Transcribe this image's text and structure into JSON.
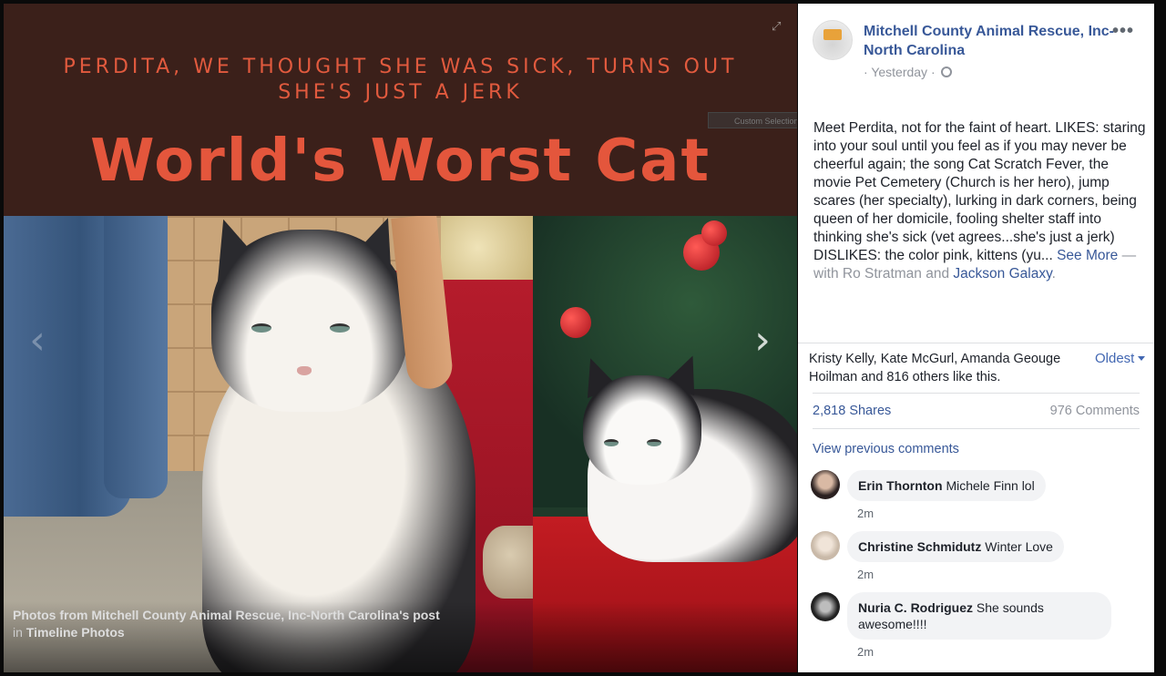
{
  "viewer": {
    "banner": {
      "subtitle_line1": "PERDITA, WE THOUGHT SHE WAS SICK, TURNS OUT",
      "subtitle_line2": "SHE'S JUST A JERK",
      "title": "World's Worst Cat"
    },
    "overlay_label": "Custom Selection",
    "caption": {
      "line1": "Photos from Mitchell County Animal Rescue, Inc-North Carolina's post",
      "line2_prefix": "in",
      "line2_link": "Timeline Photos"
    },
    "icons": {
      "expand": "expand-icon",
      "prev": "chevron-left-icon",
      "next": "chevron-right-icon"
    }
  },
  "post": {
    "page_name": "Mitchell County Animal Rescue, Inc-North Carolina",
    "timestamp": "Yesterday",
    "more_label": "•••",
    "body": "Meet Perdita, not for the faint of heart. LIKES: staring into your soul until you feel as if you may never be cheerful again; the song Cat Scratch Fever, the movie Pet Cemetery (Church is her hero), jump scares (her specialty), lurking in dark corners, being queen of her domicile, fooling shelter staff into thinking she's sick (vet agrees...she's just a jerk) DISLIKES: the color pink, kittens (yu...",
    "see_more": "See More",
    "with_prefix": "— with",
    "tagged_1": "Ro Stratman",
    "with_and": "and",
    "tagged_2": "Jackson Galaxy",
    "period": "."
  },
  "engagement": {
    "likes": "Kristy Kelly, Kate McGurl, Amanda Geouge Hoilman and 816 others like this.",
    "sort": "Oldest",
    "shares": "2,818 Shares",
    "comments": "976 Comments",
    "view_previous": "View previous comments"
  },
  "comments": [
    {
      "author": "Erin Thornton",
      "text": "Michele Finn lol",
      "time": "2m"
    },
    {
      "author": "Christine Schmidutz",
      "text": "Winter Love",
      "time": "2m"
    },
    {
      "author": "Nuria C. Rodriguez",
      "text": "She sounds awesome!!!!",
      "time": "2m"
    }
  ],
  "colors": {
    "banner_bg": "#3b201a",
    "banner_text": "#e4563c",
    "link": "#385898",
    "muted": "#90949c"
  }
}
